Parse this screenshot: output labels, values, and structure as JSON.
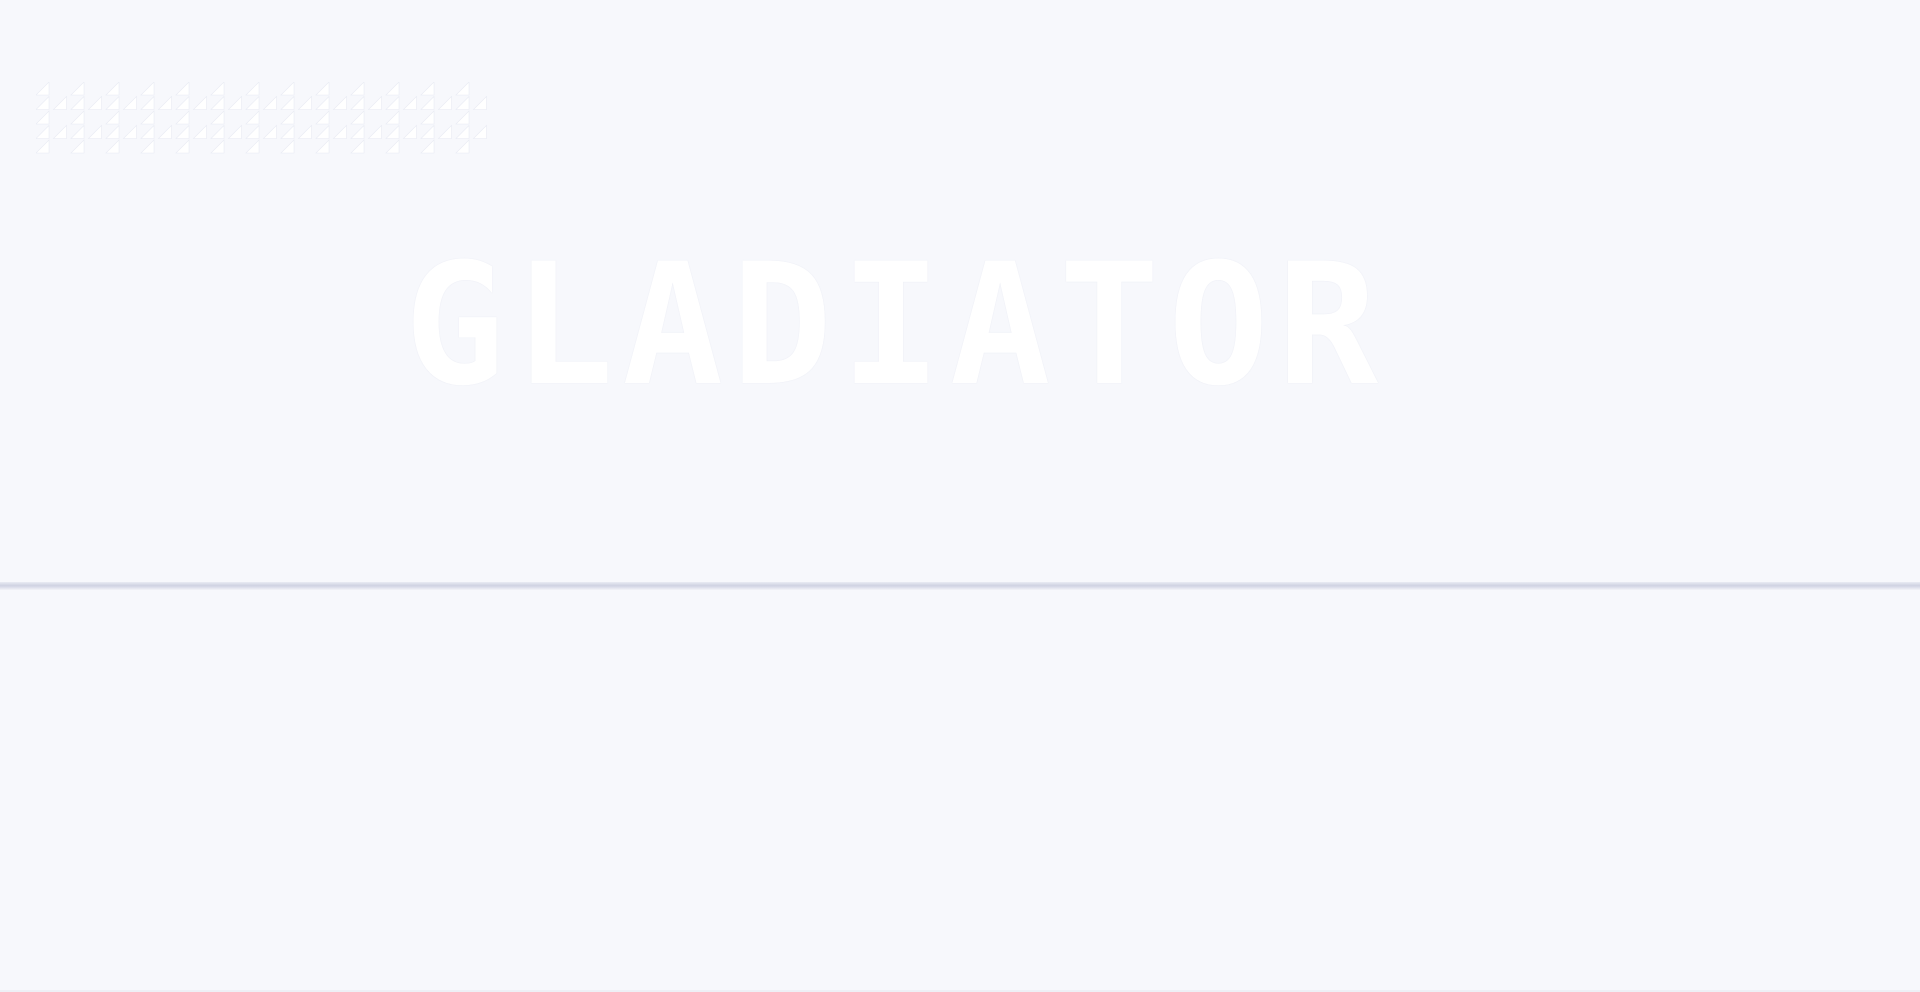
{
  "hero": {
    "logo_text": "GLADIATOR",
    "pattern_icon": "triangle-pattern-icon"
  },
  "colors": {
    "background": "#f7f8fc",
    "logo": "#ffffff",
    "divider": "#cfd2e2"
  }
}
